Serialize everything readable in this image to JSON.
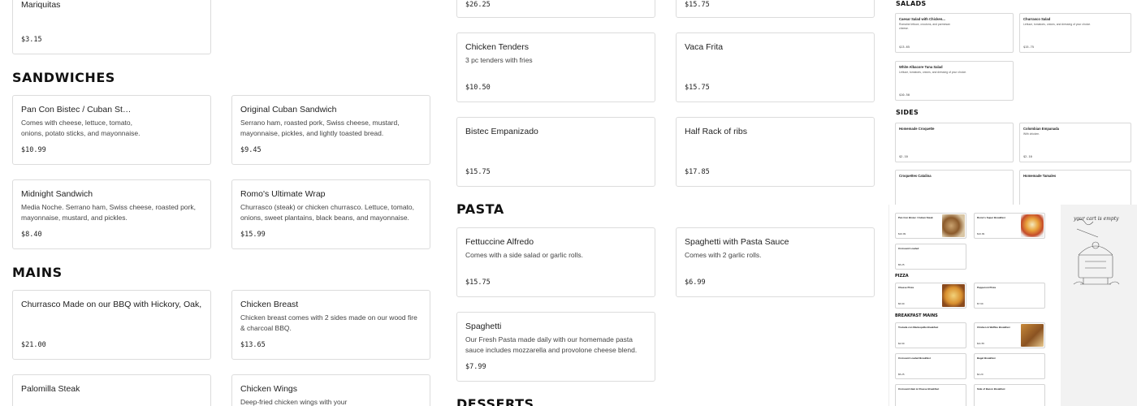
{
  "sections": {
    "sandwiches": "SANDWICHES",
    "mains": "MAINS",
    "pasta": "PASTA",
    "desserts": "DESSERTS"
  },
  "col1_top": {
    "name": "Mariquitas",
    "price": "$3.15"
  },
  "col3_top": {
    "price": "$26.25"
  },
  "col4_top": {
    "price": "$15.75"
  },
  "sandwiches": [
    {
      "name": "Pan Con Bistec / Cuban Steak Sandwich",
      "desc": "Comes with cheese, lettuce, tomato, onions, potato sticks, and mayonnaise.",
      "price": "$10.99"
    },
    {
      "name": "Original Cuban Sandwich",
      "desc": "Serrano ham, roasted pork, Swiss cheese, mustard, mayonnaise, pickles, and lightly toasted bread.",
      "price": "$9.45"
    },
    {
      "name": "Midnight Sandwich",
      "desc": "Media Noche. Serrano ham, Swiss cheese, roasted pork, mayonnaise, mustard, and pickles.",
      "price": "$8.40"
    },
    {
      "name": "Romo's Ultimate Wrap",
      "desc": "Churrasco (steak) or chicken churrasco. Lettuce, tomato, onions, sweet plantains, black beans, and mayonnaise.",
      "price": "$15.99"
    }
  ],
  "mains": [
    {
      "name": "Churrasco Made on our BBQ with Hickory, Oak, & Mesquite",
      "desc": "",
      "price": "$21.00"
    },
    {
      "name": "Chicken Breast",
      "desc": "Chicken breast comes with 2 sides made on our wood fire & charcoal BBQ.",
      "price": "$13.65"
    },
    {
      "name": "Palomilla Steak",
      "desc": "",
      "price": ""
    },
    {
      "name": "Chicken Wings",
      "desc": "Deep-fried chicken wings with your",
      "price": ""
    }
  ],
  "col3": [
    {
      "name": "Chicken Tenders",
      "desc": "3 pc tenders with fries",
      "price": "$10.50"
    },
    {
      "name": "Bistec Empanizado",
      "desc": "",
      "price": "$15.75"
    }
  ],
  "col4": [
    {
      "name": "Vaca Frita",
      "desc": "",
      "price": "$15.75"
    },
    {
      "name": "Half Rack of ribs",
      "desc": "",
      "price": "$17.85"
    }
  ],
  "pasta": [
    {
      "name": "Fettuccine Alfredo",
      "desc": "Comes with a side salad or garlic rolls.",
      "price": "$15.75"
    },
    {
      "name": "Spaghetti with Pasta Sauce",
      "desc": "Comes with 2 garlic rolls.",
      "price": "$6.99"
    },
    {
      "name": "Spaghetti",
      "desc": "Our Fresh Pasta made daily with our homemade pasta sauce includes mozzarella and provolone cheese blend.",
      "price": "$7.99"
    }
  ],
  "preview": {
    "salads_title": "SALADS",
    "sides_title": "SIDES",
    "salads": [
      {
        "name": "Caesar Salad with Chicken...",
        "desc": "Romaine lettuce, croutons, and parmesan cheese.",
        "price": "$13.65"
      },
      {
        "name": "Churrasco Salad",
        "desc": "Lettuce, tomatoes, onions, and dressing of your choice.",
        "price": "$15.75"
      },
      {
        "name": "White Albacore Tuna Salad",
        "desc": "Lettuce, tomatoes, onions, and dressing of your choice.",
        "price": "$10.50"
      }
    ],
    "sides": [
      {
        "name": "Homemade Croquette",
        "desc": "",
        "price": "$2.10"
      },
      {
        "name": "Colombian Empanada",
        "desc": "With chicken.",
        "price": "$2.10"
      },
      {
        "name": "Croquettes Catalina",
        "desc": "",
        "price": ""
      },
      {
        "name": "Homemade Tamales",
        "desc": "",
        "price": ""
      }
    ]
  },
  "mini": {
    "pizza_title": "PIZZA",
    "breakfast_title": "BREAKFAST MAINS",
    "items": [
      {
        "name": "Pan Con Bistec / Cuban Steak",
        "price": "$10.99"
      },
      {
        "name": "Romo's Super Breakfast",
        "price": "$10.99"
      },
      {
        "name": "Croissant Loaded",
        "price": "$5.25"
      },
      {
        "name": "Cheese Pizza",
        "price": "$6.99"
      },
      {
        "name": "Pepperoni Pizza",
        "price": "$7.99"
      },
      {
        "name": "Tostada con Mantequilla Breakfast",
        "price": "$2.99"
      },
      {
        "name": "Chicken & Waffles Breakfast",
        "price": "$11.55"
      },
      {
        "name": "Croissant Loaded Breakfast",
        "price": "$5.25"
      },
      {
        "name": "Bagel Breakfast",
        "price": "$4.20"
      },
      {
        "name": "Croissant Ham & Cheese Breakfast",
        "price": ""
      },
      {
        "name": "Side of Bacon Breakfast",
        "price": ""
      }
    ],
    "quote": "your cart is empty"
  }
}
